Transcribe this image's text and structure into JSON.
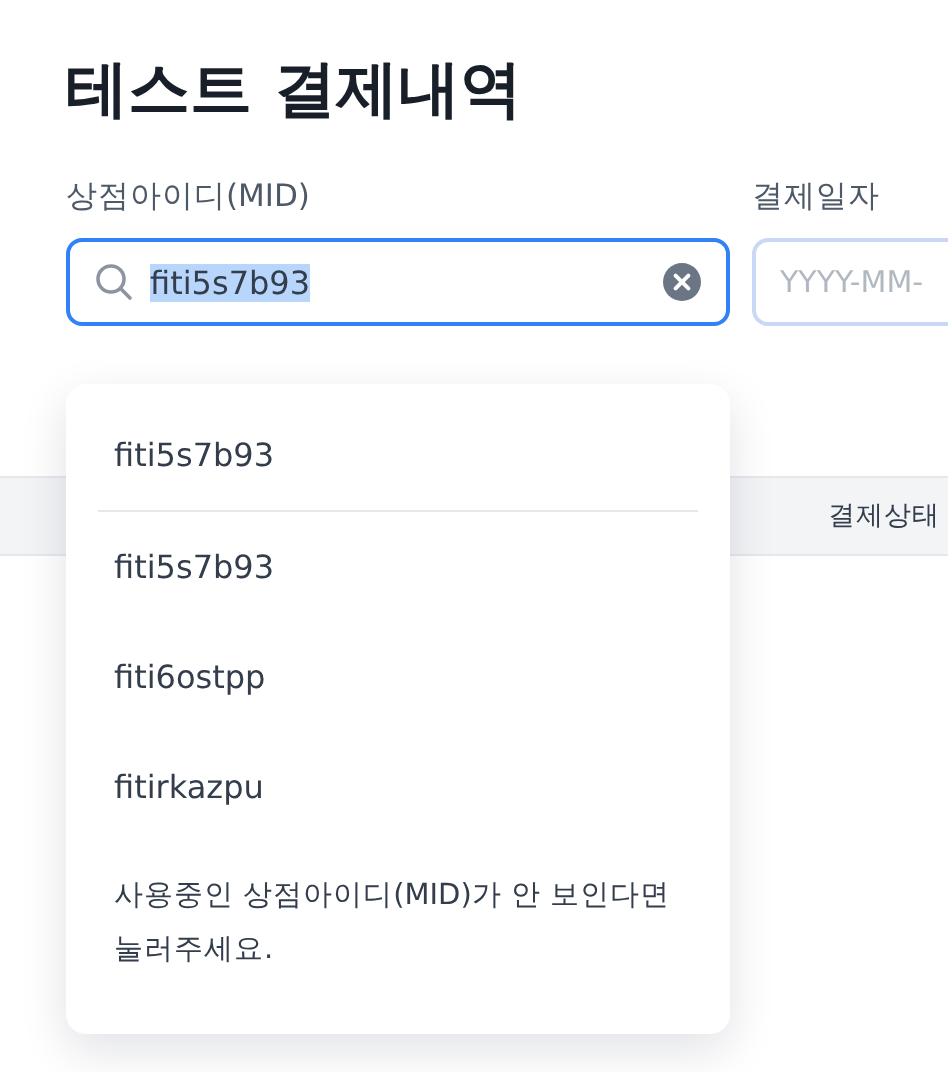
{
  "title": "테스트 결제내역",
  "filters": [
    {
      "kind": "search",
      "label": "상점아이디(MID)",
      "value": "fiti5s7b93",
      "value_highlighted": true,
      "focused": true
    },
    {
      "kind": "date",
      "label": "결제일자",
      "placeholder": "YYYY-MM-",
      "focused": false
    }
  ],
  "table": {
    "columns": [
      "결제상태"
    ]
  },
  "dropdown": {
    "recent": [
      "fiti5s7b93"
    ],
    "options": [
      "fiti5s7b93",
      "fiti6ostpp",
      "fitirkazpu"
    ],
    "help": "사용중인 상점아이디(MID)가 안 보인다면 눌러주세요."
  }
}
